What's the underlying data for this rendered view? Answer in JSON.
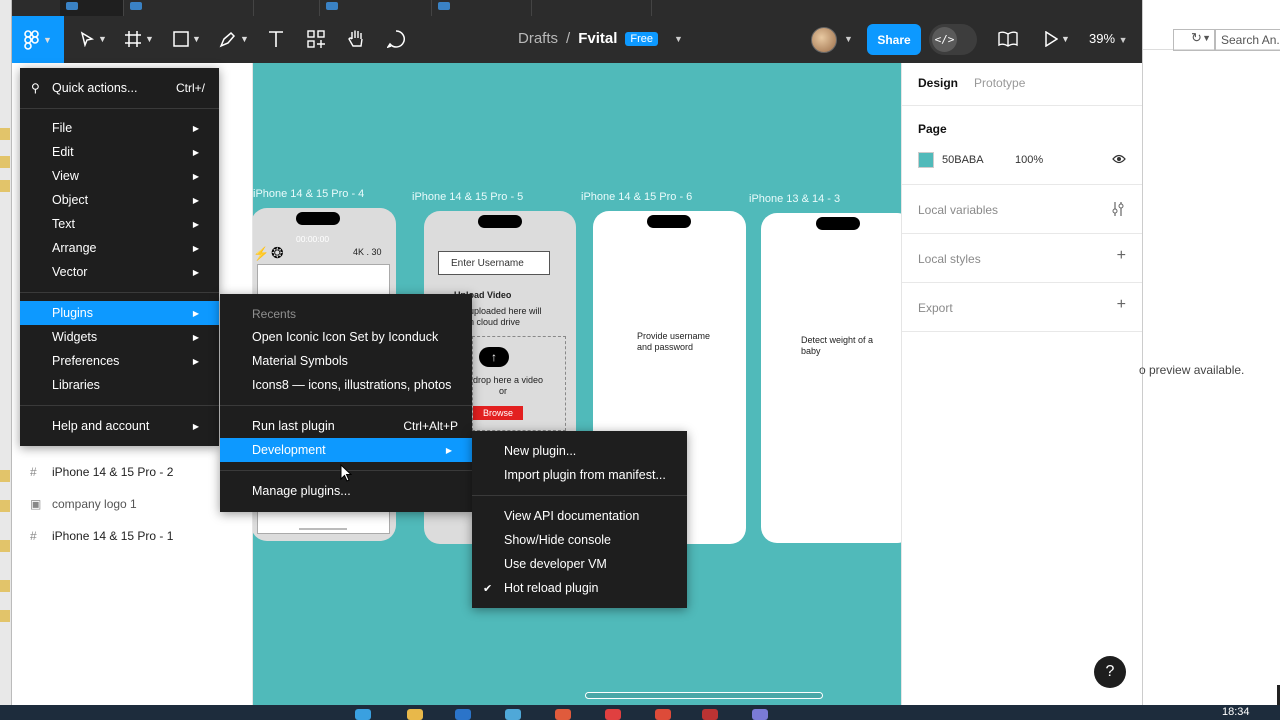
{
  "window": {
    "breadcrumb_root": "Drafts",
    "separator": "/",
    "file_name": "Fvital",
    "plan_badge": "Free",
    "share_label": "Share",
    "zoom": "39%"
  },
  "main_menu": {
    "quick_actions": "Quick actions...",
    "quick_actions_shortcut": "Ctrl+/",
    "items": [
      {
        "label": "File"
      },
      {
        "label": "Edit"
      },
      {
        "label": "View"
      },
      {
        "label": "Object"
      },
      {
        "label": "Text"
      },
      {
        "label": "Arrange"
      },
      {
        "label": "Vector"
      }
    ],
    "items2": [
      {
        "label": "Plugins"
      },
      {
        "label": "Widgets"
      },
      {
        "label": "Preferences"
      },
      {
        "label": "Libraries"
      }
    ],
    "help": "Help and account"
  },
  "plugins_menu": {
    "recents_header": "Recents",
    "recents": [
      {
        "label": "Open Iconic Icon Set by Iconduck"
      },
      {
        "label": "Material Symbols"
      },
      {
        "label": "Icons8 — icons, illustrations, photos"
      }
    ],
    "run_last": "Run last plugin",
    "run_last_shortcut": "Ctrl+Alt+P",
    "development": "Development",
    "manage": "Manage plugins..."
  },
  "dev_menu": {
    "new_plugin": "New plugin...",
    "import_manifest": "Import plugin from manifest...",
    "api_docs": "View API documentation",
    "console": "Show/Hide console",
    "dev_vm": "Use developer VM",
    "hot_reload": "Hot reload plugin",
    "check": "✔"
  },
  "layers": [
    {
      "label": "iPhone 14 & 15 Pro - 2",
      "icon": "frame-icon"
    },
    {
      "label": "company logo 1",
      "icon": "image-icon"
    },
    {
      "label": "iPhone 14 & 15 Pro - 1",
      "icon": "frame-icon"
    }
  ],
  "canvas": {
    "frames": [
      {
        "label": "iPhone 14 & 15 Pro - 4"
      },
      {
        "label": "iPhone 14 & 15 Pro - 5"
      },
      {
        "label": "iPhone 14 & 15 Pro - 6"
      },
      {
        "label": "iPhone 13 & 14 - 3"
      }
    ],
    "f4_timer": "00:00:00",
    "f4_res": "4K . 30",
    "f5_input": "Enter Username",
    "f5_upload_title": "Upload Video",
    "f5_upload_desc": "uploaded here will\nn cloud drive",
    "f5_drop": "drop here a video\nor",
    "f5_browse": "Browse",
    "f6_text": "Provide username\nand password",
    "f7_text": "Detect weight of a\nbaby"
  },
  "right_panel": {
    "tab_design": "Design",
    "tab_prototype": "Prototype",
    "page_label": "Page",
    "page_color": "50BABA",
    "page_opacity": "100%",
    "local_variables": "Local variables",
    "local_styles": "Local styles",
    "export": "Export",
    "help": "?"
  },
  "external": {
    "search_placeholder": "Search An...",
    "message": "o preview available."
  },
  "taskbar": {
    "clock": "18:34"
  },
  "colors": {
    "accent": "#0d99ff",
    "canvas": "#50BABA",
    "menu_bg": "#1e1e1e",
    "toolbar_bg": "#2c2c2c"
  }
}
